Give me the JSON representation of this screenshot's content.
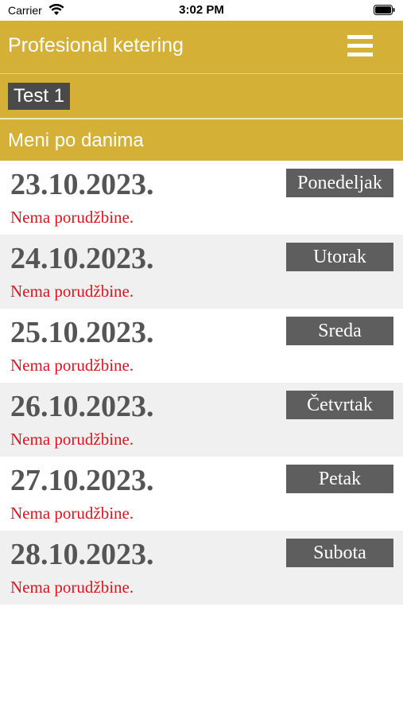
{
  "status_bar": {
    "carrier": "Carrier",
    "time": "3:02 PM",
    "icons": [
      "wifi-icon",
      "battery-icon"
    ]
  },
  "header": {
    "title": "Profesional ketering",
    "menu_icon": "hamburger-menu-icon"
  },
  "user": {
    "name": "Test 1"
  },
  "section": {
    "title": "Meni po danima"
  },
  "days": [
    {
      "date": "23.10.2023.",
      "day": "Ponedeljak",
      "status": "Nema porudžbine."
    },
    {
      "date": "24.10.2023.",
      "day": "Utorak",
      "status": "Nema porudžbine."
    },
    {
      "date": "25.10.2023.",
      "day": "Sreda",
      "status": "Nema porudžbine."
    },
    {
      "date": "26.10.2023.",
      "day": "Četvrtak",
      "status": "Nema porudžbine."
    },
    {
      "date": "27.10.2023.",
      "day": "Petak",
      "status": "Nema porudžbine."
    },
    {
      "date": "28.10.2023.",
      "day": "Subota",
      "status": "Nema porudžbine."
    }
  ],
  "colors": {
    "brand": "#d4b036",
    "date_text": "#555555",
    "day_badge": "#5e5e5e",
    "status_text": "#e0141e",
    "alt_row": "#f0f0f0"
  }
}
